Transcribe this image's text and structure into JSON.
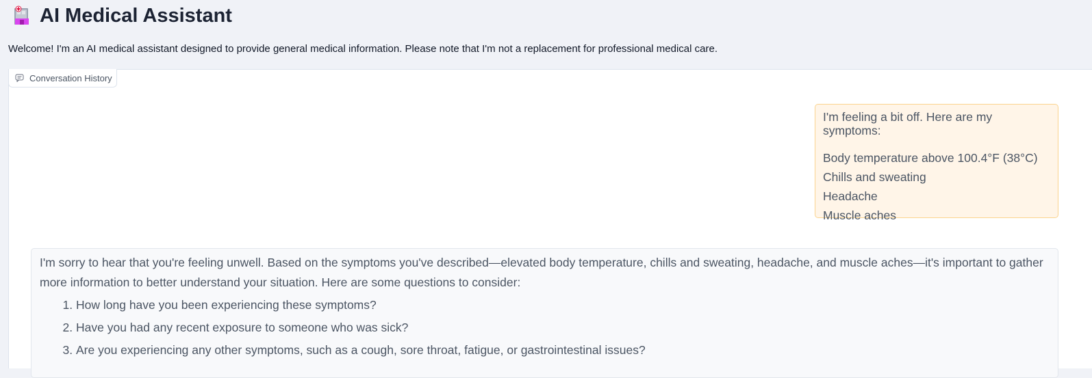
{
  "header": {
    "icon": "hospital-icon",
    "title": "AI Medical Assistant"
  },
  "welcome_text": "Welcome! I'm an AI medical assistant designed to provide general medical information. Please note that I'm not a replacement for professional medical care.",
  "tab": {
    "icon": "chat-icon",
    "label": "Conversation History"
  },
  "messages": {
    "user": {
      "intro": "I'm feeling a bit off. Here are my symptoms:",
      "symptoms": [
        "Body temperature above 100.4°F (38°C)",
        "Chills and sweating",
        "Headache",
        "Muscle aches"
      ]
    },
    "assistant": {
      "intro": "I'm sorry to hear that you're feeling unwell. Based on the symptoms you've described—elevated body temperature, chills and sweating, headache, and muscle aches—it's important to gather more information to better understand your situation. Here are some questions to consider:",
      "questions": [
        "How long have you been experiencing these symptoms?",
        "Have you had any recent exposure to someone who was sick?",
        "Are you experiencing any other symptoms, such as a cough, sore throat, fatigue, or gastrointestinal issues?"
      ]
    }
  },
  "colors": {
    "user_bubble_bg": "#fff5e8",
    "user_bubble_border": "#fbd38d",
    "assistant_bubble_bg": "#f8f9fb",
    "page_bg": "#f0f2f7"
  }
}
